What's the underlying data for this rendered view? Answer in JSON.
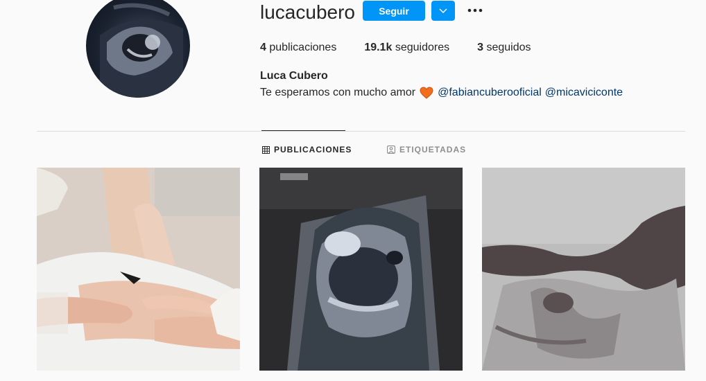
{
  "profile": {
    "username": "lucacubero",
    "follow_label": "Seguir",
    "full_name": "Luca Cubero",
    "bio_text": "Te esperamos con mucho amor",
    "mentions": [
      "@fabiancuberooficial",
      "@micaviciconte"
    ]
  },
  "stats": {
    "posts_count": "4",
    "posts_label": "publicaciones",
    "followers_count": "19.1k",
    "followers_label": "seguidores",
    "following_count": "3",
    "following_label": "seguidos"
  },
  "tabs": [
    {
      "label": "PUBLICACIONES",
      "icon": "grid-icon"
    },
    {
      "label": "ETIQUETADAS",
      "icon": "tagged-icon"
    }
  ],
  "posts": [
    {
      "icon": "belly-photo"
    },
    {
      "icon": "ultrasound-printout"
    },
    {
      "icon": "ultrasound-scan"
    }
  ],
  "colors": {
    "accent": "#0095f6",
    "mention": "#00376b",
    "heart": "#f26d1d"
  }
}
